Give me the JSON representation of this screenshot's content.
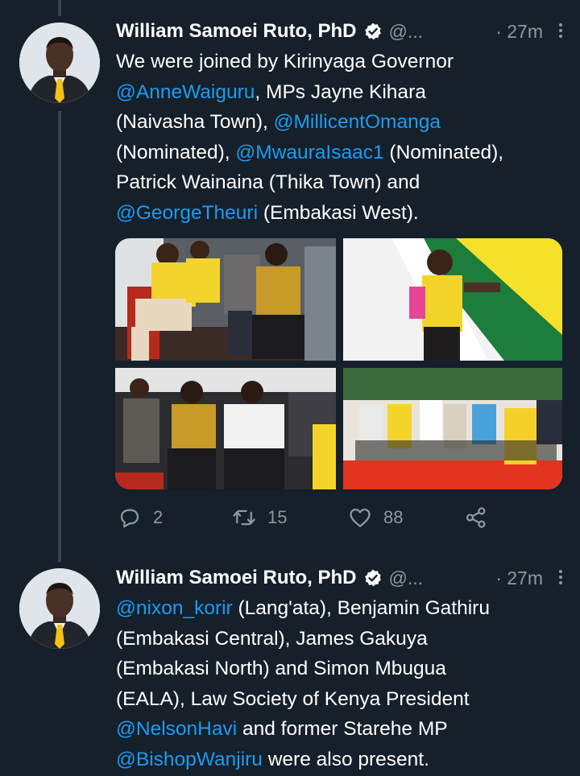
{
  "tweets": [
    {
      "author_name": "William Samoei Ruto, PhD",
      "handle": "@...",
      "time": "· 27m",
      "segments": [
        {
          "text": "We were joined by Kirinyaga Governor\n",
          "type": "text"
        },
        {
          "text": "@AnneWaiguru",
          "type": "mention"
        },
        {
          "text": ", MPs Jayne Kihara\n(Naivasha Town), ",
          "type": "text"
        },
        {
          "text": "@MillicentOmanga",
          "type": "mention"
        },
        {
          "text": "\n(Nominated), ",
          "type": "text"
        },
        {
          "text": "@MwauraIsaac1",
          "type": "mention"
        },
        {
          "text": " (Nominated),\nPatrick Wainaina (Thika Town) and\n",
          "type": "text"
        },
        {
          "text": "@GeorgeTheuri",
          "type": "mention"
        },
        {
          "text": " (Embakasi West).",
          "type": "text"
        }
      ],
      "actions": {
        "reply_count": "2",
        "retweet_count": "15",
        "like_count": "88"
      }
    },
    {
      "author_name": "William Samoei Ruto, PhD",
      "handle": "@...",
      "time": "· 27m",
      "segments": [
        {
          "text": "@nixon_korir",
          "type": "mention"
        },
        {
          "text": " (Lang'ata), Benjamin Gathiru\n(Embakasi Central), James Gakuya\n(Embakasi North) and Simon Mbugua\n(EALA), Law Society of Kenya President\n",
          "type": "text"
        },
        {
          "text": "@NelsonHavi",
          "type": "mention"
        },
        {
          "text": " and former Starehe MP\n",
          "type": "text"
        },
        {
          "text": "@BishopWanjiru",
          "type": "mention"
        },
        {
          "text": " were also present.",
          "type": "text"
        }
      ]
    }
  ],
  "icons": {
    "reply": "reply-icon",
    "retweet": "retweet-icon",
    "like": "heart-icon",
    "share": "share-icon",
    "verified": "verified-badge-icon",
    "more": "more-options-icon"
  },
  "colors": {
    "background": "#15202b",
    "mention": "#1d9bf0",
    "secondary_text": "#8b98a5",
    "thread_line": "#38444d"
  }
}
